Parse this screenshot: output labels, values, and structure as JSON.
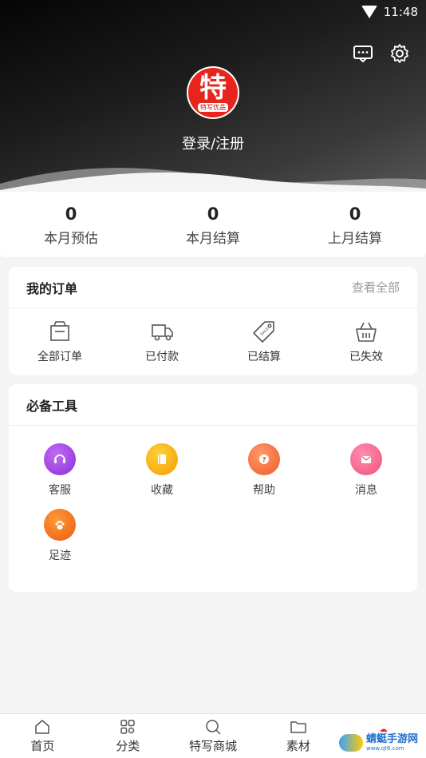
{
  "status": {
    "time": "11:48"
  },
  "header": {
    "user_action": "登录/注册",
    "avatar_char": "特",
    "avatar_caption": "特写优品"
  },
  "stats": [
    {
      "value": "0",
      "label": "本月预估"
    },
    {
      "value": "0",
      "label": "本月结算"
    },
    {
      "value": "0",
      "label": "上月结算"
    }
  ],
  "orders": {
    "title": "我的订单",
    "view_all": "查看全部",
    "items": [
      {
        "label": "全部订单",
        "icon": "bag-icon"
      },
      {
        "label": "已付款",
        "icon": "truck-icon"
      },
      {
        "label": "已结算",
        "icon": "sale-tag-icon"
      },
      {
        "label": "已失效",
        "icon": "basket-icon"
      }
    ]
  },
  "tools": {
    "title": "必备工具",
    "items": [
      {
        "label": "客服",
        "icon": "headset-icon",
        "color": "#9b3fe0"
      },
      {
        "label": "收藏",
        "icon": "book-icon",
        "color": "#f7a800"
      },
      {
        "label": "帮助",
        "icon": "question-icon",
        "color": "#f26b3a"
      },
      {
        "label": "消息",
        "icon": "mail-icon",
        "color": "#f25c8a"
      },
      {
        "label": "足迹",
        "icon": "paw-icon",
        "color": "#f06a1f"
      }
    ]
  },
  "tabbar": [
    {
      "label": "首页",
      "icon": "home-icon"
    },
    {
      "label": "分类",
      "icon": "grid-icon"
    },
    {
      "label": "特写商城",
      "icon": "search-icon"
    },
    {
      "label": "素材",
      "icon": "folder-icon"
    },
    {
      "label": "",
      "icon": "user-icon"
    }
  ],
  "watermark": {
    "name": "蜻蜓手游网",
    "url": "www.qt6.com"
  }
}
